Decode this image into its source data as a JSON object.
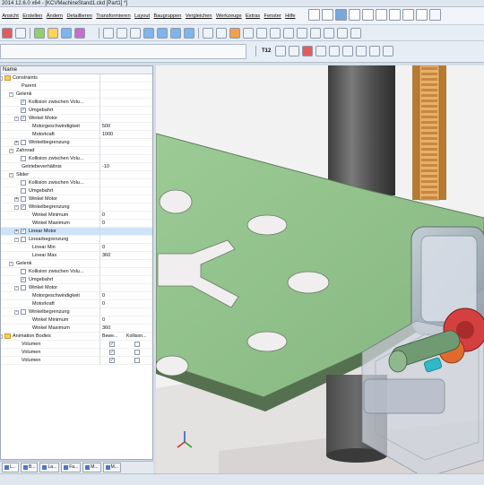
{
  "window": {
    "title": "2014 12.6.0 x64 - [KCVMachineStand1.ckd [Part1] *]"
  },
  "menubar": {
    "items": [
      "Ansicht",
      "Erstellen",
      "Ändern",
      "Detaillieren",
      "Transformieren",
      "Layout",
      "Baugruppen",
      "Vergleichen",
      "Werkzeuge",
      "Extras",
      "Fenster",
      "Hilfe"
    ]
  },
  "toolbar2": {
    "label": "T12"
  },
  "tree": {
    "header": "Name",
    "columns": {
      "bewegung": "Bewe...",
      "kollision": "Kollison..."
    },
    "rows": [
      {
        "name": "Constraints",
        "indent": 0,
        "exp": "-",
        "folder": true
      },
      {
        "name": "Parent",
        "indent": 3
      },
      {
        "name": "Gelenk",
        "indent": 2,
        "exp": "-"
      },
      {
        "name": "Kollision zwischen Volu...",
        "indent": 3,
        "cb": true
      },
      {
        "name": "Umgebahrt",
        "indent": 3,
        "cb": true
      },
      {
        "name": "Winkel Motor",
        "indent": 3,
        "exp": "-",
        "cb": true
      },
      {
        "name": "Motorgeschwindigkeit",
        "indent": 5,
        "value": "500"
      },
      {
        "name": "Motorkraft",
        "indent": 5,
        "value": "1000"
      },
      {
        "name": "Winkelbegrenzung",
        "indent": 3,
        "exp": "+",
        "cb": false
      },
      {
        "name": "Zahnrad",
        "indent": 2,
        "exp": "-"
      },
      {
        "name": "Kollision zwischen Volu...",
        "indent": 3,
        "cb": false
      },
      {
        "name": "Getriebeverhältnis",
        "indent": 3,
        "value": "-10"
      },
      {
        "name": "Slider",
        "indent": 2,
        "exp": "-"
      },
      {
        "name": "Kollision zwischen Volu...",
        "indent": 3,
        "cb": false
      },
      {
        "name": "Umgebahrt",
        "indent": 3,
        "cb": false
      },
      {
        "name": "Winkel Motor",
        "indent": 3,
        "exp": "+",
        "cb": false
      },
      {
        "name": "Winkelbegrenzung",
        "indent": 3,
        "exp": "-",
        "cb": true
      },
      {
        "name": "Winkel Minimum",
        "indent": 5,
        "value": "0"
      },
      {
        "name": "Winkel Maximum",
        "indent": 5,
        "value": "0"
      },
      {
        "name": "Linear Motor",
        "indent": 3,
        "exp": "+",
        "cb": true,
        "sel": true
      },
      {
        "name": "Linearbegrenzung",
        "indent": 3,
        "exp": "-",
        "cb": false
      },
      {
        "name": "Linear Min",
        "indent": 5,
        "value": "0"
      },
      {
        "name": "Linear Max",
        "indent": 5,
        "value": "360"
      },
      {
        "name": "Gelenk",
        "indent": 2,
        "exp": "-"
      },
      {
        "name": "Kollision zwischen Volu...",
        "indent": 3,
        "cb": false
      },
      {
        "name": "Umgebahrt",
        "indent": 3,
        "cb": true
      },
      {
        "name": "Winkel Motor",
        "indent": 3,
        "exp": "-",
        "cb": false
      },
      {
        "name": "Motorgeschwindigkeit",
        "indent": 5,
        "value": "0"
      },
      {
        "name": "Motorkraft",
        "indent": 5,
        "value": "0"
      },
      {
        "name": "Winkelbegrenzung",
        "indent": 3,
        "exp": "-",
        "cb": false
      },
      {
        "name": "Winkel Minimum",
        "indent": 5,
        "value": "0"
      },
      {
        "name": "Winkel Maximum",
        "indent": 5,
        "value": "360"
      },
      {
        "name": "Animation Bodies",
        "indent": 0,
        "exp": "-",
        "folder": true,
        "header": true
      },
      {
        "name": "Volumen",
        "indent": 3,
        "c1": true,
        "c2": false
      },
      {
        "name": "Volumen",
        "indent": 3,
        "c1": true,
        "c2": false
      },
      {
        "name": "Volumen",
        "indent": 3,
        "c1": true,
        "c2": false
      }
    ]
  },
  "tabs": [
    "L...",
    "B...",
    "La...",
    "Fa...",
    "M...",
    "M..."
  ],
  "colors": {
    "plate": "#8fbf8a",
    "plate_side": "#4f6e4b",
    "column": "#5a5a5a",
    "rack": "#e2a85a",
    "gear": "#d43a3a",
    "housing": "#a9b5c4"
  }
}
